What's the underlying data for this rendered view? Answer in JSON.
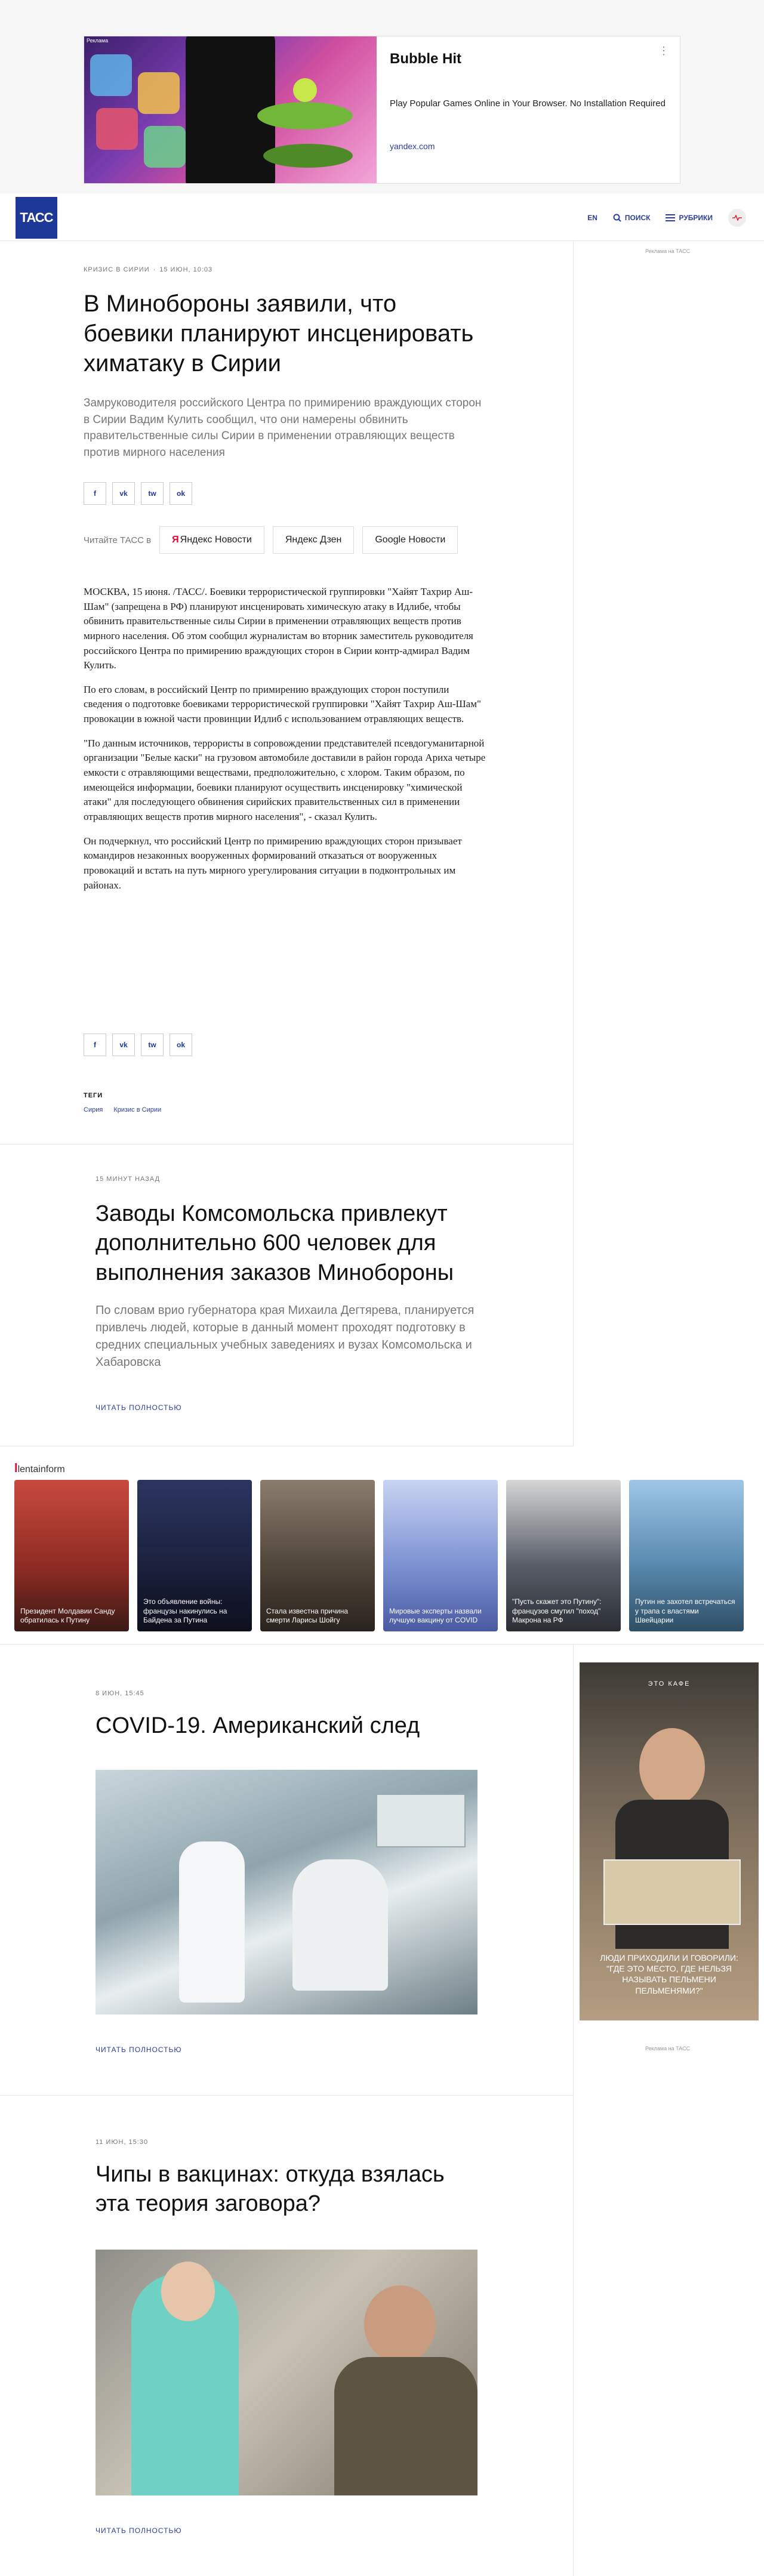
{
  "ad_top": {
    "label": "Реклама",
    "title": "Bubble Hit",
    "description": "Play Popular Games Online in Your Browser. No Installation Required",
    "domain": "yandex.com",
    "menu": "⋮"
  },
  "header": {
    "logo": "ТАСС",
    "lang": "EN",
    "search": "Поиск",
    "menu": "Рубрики"
  },
  "side": {
    "ad_note": "Реклама на ТАСС",
    "ad_caption": "ЛЮДИ ПРИХОДИЛИ И ГОВОРИЛИ: \"ГДЕ ЭТО МЕСТО, ГДЕ НЕЛЬЗЯ НАЗЫВАТЬ ПЕЛЬМЕНИ ПЕЛЬМЕНЯМИ?\"",
    "ad_badge": "ЭТО КАФЕ"
  },
  "article": {
    "rubric": "Кризис в Сирии",
    "date": "15 июн, 10:03",
    "title": "В Минобороны заявили, что боевики планируют инсценировать химатаку в Сирии",
    "lead": "Замруководителя российского Центра по примирению враждующих сторон в Сирии Вадим Кулить сообщил, что они намерены обвинить правительственные силы Сирии в применении отравляющих веществ против мирного населения",
    "share": [
      "f",
      "vk",
      "tw",
      "ok"
    ],
    "read_in_label": "Читайте ТАСС в",
    "read_in": [
      "Яндекс Новости",
      "Яндекс Дзен",
      "Google Новости"
    ],
    "paragraphs": [
      "МОСКВА, 15 июня. /ТАСС/. Боевики террористической группировки \"Хайят Тахрир Аш-Шам\" (запрещена в РФ) планируют инсценировать химическую атаку в Идлибе, чтобы обвинить правительственные силы Сирии в применении отравляющих веществ против мирного населения. Об этом сообщил журналистам во вторник заместитель руководителя российского Центра по примирению враждующих сторон в Сирии контр-адмирал Вадим Кулить.",
      "По его словам, в российский Центр по примирению враждующих сторон поступили сведения о подготовке боевиками террористической группировки \"Хайят Тахрир Аш-Шам\" провокации в южной части провинции Идлиб с использованием отравляющих веществ.",
      "\"По данным источников, террористы в сопровождении представителей псевдогуманитарной организации \"Белые каски\" на грузовом автомобиле доставили в район города Ариха четыре емкости с отравляющими веществами, предположительно, с хлором. Таким образом, по имеющейся информации, боевики планируют осуществить инсценировку \"химической атаки\" для последующего обвинения сирийских правительственных сил в применении отравляющих веществ против мирного населения\", - сказал Кулить.",
      "Он подчеркнул, что российский Центр по примирению враждующих сторон призывает командиров незаконных вооруженных формирований отказаться от вооруженных провокаций и встать на путь мирного урегулирования ситуации в подконтрольных им районах."
    ],
    "tags_title": "Теги",
    "tags": [
      "Сирия",
      "Кризис в Сирии"
    ]
  },
  "teaser1": {
    "date": "15 минут назад",
    "title": "Заводы Комсомольска привлекут дополнительно 600 человек для выполнения заказов Минобороны",
    "lead": "По словам врио губернатора края Михаила Дегтярева, планируется привлечь людей, которые в данный момент проходят подготовку в средних специальных учебных заведениях и вузах Комсомольска и Хабаровска",
    "more": "Читать полностью"
  },
  "lenta": {
    "brand_prefix": "l",
    "brand": "lentainform",
    "cards": [
      {
        "caption": "Президент Молдавии Санду обратилась к Путину",
        "bg": "#b0322b"
      },
      {
        "caption": "Это объявление войны: французы накинулись на Байдена за Путина",
        "bg": "#23294a"
      },
      {
        "caption": "Стала известна причина смерти Ларисы Шойгу",
        "bg": "#6b6055"
      },
      {
        "caption": "Мировые эксперты назвали лучшую вакцину от COVID",
        "bg": "#6f84c9"
      },
      {
        "caption": "\"Пусть скажет это Путину\": французов смутил \"поход\" Макрона на РФ",
        "bg": "#4e5460"
      },
      {
        "caption": "Путин не захотел встречаться у трапа с властями Швейцарии",
        "bg": "#5e8fb0"
      }
    ]
  },
  "teaser2": {
    "date": "8 июн, 15:45",
    "title": "COVID-19. Американский след",
    "more": "Читать полностью"
  },
  "teaser3": {
    "date": "11 июн, 15:30",
    "title": "Чипы в вакцинах: откуда взялась эта теория заговора?",
    "more": "Читать полностью"
  }
}
